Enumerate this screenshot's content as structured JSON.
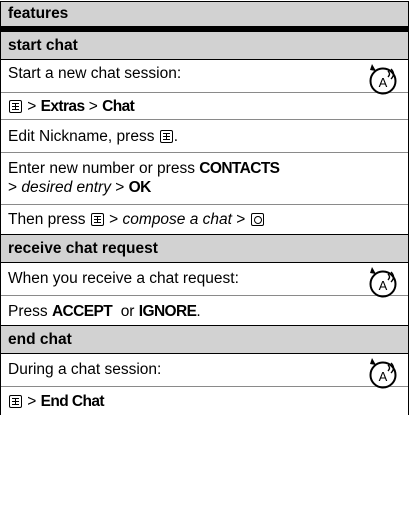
{
  "header": {
    "title": "features"
  },
  "sections": {
    "start": {
      "title": "start chat",
      "line1": "Start a new chat session:",
      "path1_sep1": " > ",
      "path1_extras": "Extras",
      "path1_sep2": " > ",
      "path1_chat": "Chat",
      "line3_pre": "Edit Nickname, press ",
      "line3_post": ".",
      "line4_pre": "Enter new number or press ",
      "line4_contacts": "CONTACTS",
      "line4b_sep1": "> ",
      "line4b_entry": "desired entry",
      "line4b_sep2": " > ",
      "line4b_ok": "OK",
      "line5_pre": "Then press ",
      "line5_sep1": " > ",
      "line5_compose": "compose a chat",
      "line5_sep2": " > "
    },
    "receive": {
      "title": "receive chat request",
      "line1": "When you receive a chat request:",
      "line2_pre": "Press ",
      "line2_accept": "ACCEPT",
      "line2_or": "  or ",
      "line2_ignore": "IGNORE",
      "line2_post": "."
    },
    "end": {
      "title": "end chat",
      "line1": "During a chat session:",
      "path_sep": " > ",
      "path_end": "End Chat"
    }
  },
  "icons": {
    "menu_key": "menu-key-icon",
    "send_key": "send-key-icon",
    "network_feature": "network-feature-antenna-icon"
  },
  "colors": {
    "header_bg": "#d2d2d2",
    "border": "#000000",
    "divider": "#8a8a8a"
  }
}
